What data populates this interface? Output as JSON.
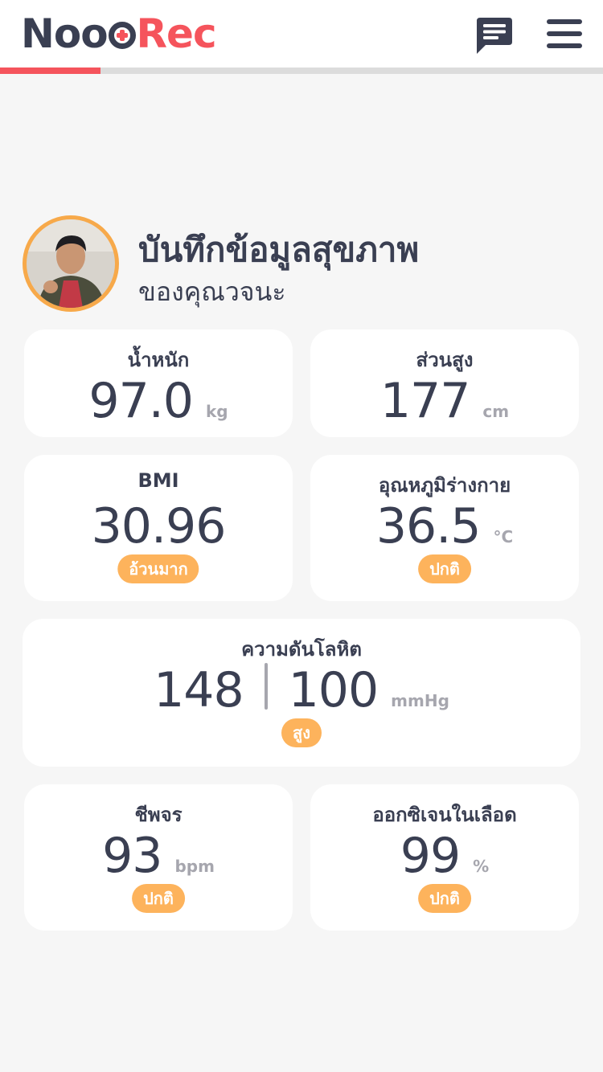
{
  "header": {
    "logo_part1": "Noo",
    "logo_part2": "Rec",
    "chat_icon": "chat-icon",
    "menu_icon": "hamburger-menu-icon",
    "progress": 0.166,
    "colors": {
      "brand_red": "#f5545c",
      "brand_dark": "#3a3f52"
    }
  },
  "profile": {
    "title": "บันทึกข้อมูลสุขภาพ",
    "subtitle": "ของคุณวจนะ"
  },
  "cards": {
    "weight": {
      "label": "น้ำหนัก",
      "value": "97.0",
      "unit": "kg"
    },
    "height": {
      "label": "ส่วนสูง",
      "value": "177",
      "unit": "cm"
    },
    "bmi": {
      "label": "BMI",
      "value": "30.96",
      "status": "อ้วนมาก"
    },
    "temperature": {
      "label": "อุณหภูมิร่างกาย",
      "value": "36.5",
      "unit": "°C",
      "status": "ปกติ"
    },
    "blood_pressure": {
      "label": "ความดันโลหิต",
      "systolic": "148",
      "diastolic": "100",
      "unit": "mmHg",
      "status": "สูง"
    },
    "pulse": {
      "label": "ชีพจร",
      "value": "93",
      "unit": "bpm",
      "status": "ปกติ"
    },
    "oxygen": {
      "label": "ออกซิเจนในเลือด",
      "value": "99",
      "unit": "%",
      "status": "ปกติ"
    }
  },
  "badge_color": "#fdb35c"
}
